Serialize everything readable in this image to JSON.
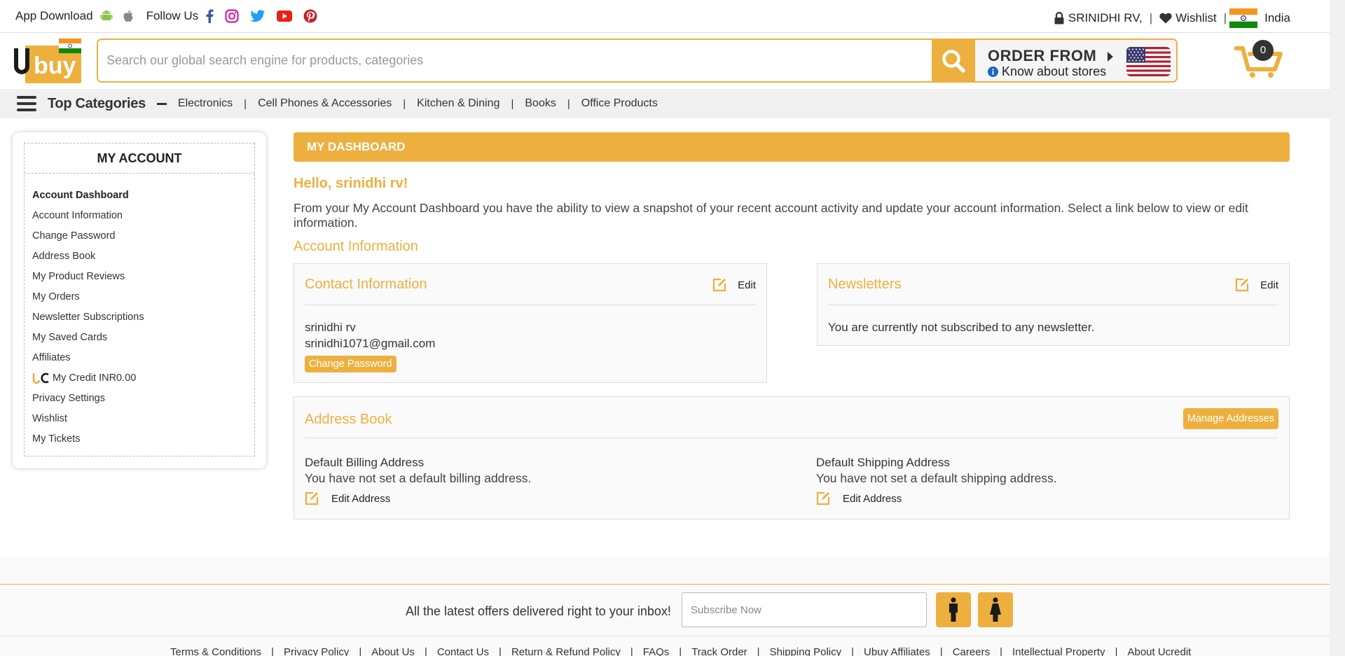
{
  "topbar": {
    "app_download": "App Download",
    "follow_us": "Follow Us",
    "user": "SRINIDHI RV,",
    "sep1": "|",
    "wishlist": "Wishlist",
    "sep2": "|",
    "country": "India",
    "social_icons": [
      "facebook-icon",
      "instagram-icon",
      "twitter-icon",
      "youtube-icon",
      "pinterest-icon"
    ]
  },
  "header": {
    "search_placeholder": "Search our global search engine for products, categories",
    "order_from": "ORDER FROM",
    "know_stores": "Know about stores",
    "cart_count": "0"
  },
  "categories": {
    "title": "Top Categories",
    "items": [
      "Electronics",
      "Cell Phones & Accessories",
      "Kitchen & Dining",
      "Books",
      "Office Products"
    ],
    "sep": "|"
  },
  "sidebar": {
    "title": "MY ACCOUNT",
    "items": [
      "Account Dashboard",
      "Account Information",
      "Change Password",
      "Address Book",
      "My Product Reviews",
      "My Orders",
      "Newsletter Subscriptions",
      "My Saved Cards",
      "Affiliates",
      "My Credit INR0.00",
      "Privacy Settings",
      "Wishlist",
      "My Tickets"
    ]
  },
  "main": {
    "dashboard_title": "MY DASHBOARD",
    "hello": "Hello, srinidhi rv!",
    "intro": "From your My Account Dashboard you have the ability to view a snapshot of your recent account activity and update your account information. Select a link below to view or edit information.",
    "account_info_title": "Account Information",
    "contact": {
      "title": "Contact Information",
      "edit": "Edit",
      "name": "srinidhi rv",
      "email": "srinidhi1071@gmail.com",
      "change_password": "Change Password"
    },
    "newsletters": {
      "title": "Newsletters",
      "edit": "Edit",
      "text": "You are currently not subscribed to any newsletter."
    },
    "address_book": {
      "title": "Address Book",
      "manage": "Manage Addresses",
      "billing_title": "Default Billing Address",
      "billing_text": "You have not set a default billing address.",
      "shipping_title": "Default Shipping Address",
      "shipping_text": "You have not set a default shipping address.",
      "edit_address": "Edit Address"
    }
  },
  "footer": {
    "newsletter_msg": "All the latest offers delivered right to your inbox!",
    "subscribe_placeholder": "Subscribe Now",
    "links": [
      "Terms & Conditions",
      "Privacy Policy",
      "About Us",
      "Contact Us",
      "Return & Refund Policy",
      "FAQs",
      "Track Order",
      "Shipping Policy",
      "Ubuy Affiliates",
      "Careers",
      "Intellectual Property",
      "About Ucredit"
    ],
    "sep": "|"
  },
  "colors": {
    "brand": "#edb03f",
    "text": "#333333"
  }
}
